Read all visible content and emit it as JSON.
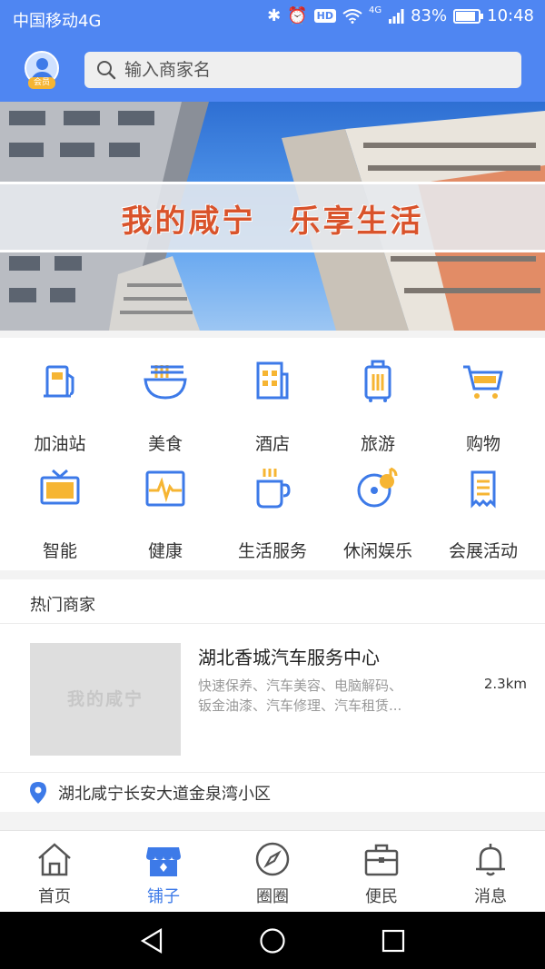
{
  "status_bar": {
    "carrier": "中国移动4G",
    "hd": "HD",
    "net": "4G",
    "battery": "83%",
    "time": "10:48"
  },
  "header": {
    "vip_badge": "会员",
    "search_placeholder": "输入商家名"
  },
  "banner": {
    "text": "我的咸宁　乐享生活"
  },
  "categories": [
    {
      "label": "加油站",
      "icon": "gas-station-icon"
    },
    {
      "label": "美食",
      "icon": "noodle-bowl-icon"
    },
    {
      "label": "酒店",
      "icon": "hotel-icon"
    },
    {
      "label": "旅游",
      "icon": "suitcase-icon"
    },
    {
      "label": "购物",
      "icon": "shopping-cart-icon"
    },
    {
      "label": "智能",
      "icon": "tv-icon"
    },
    {
      "label": "健康",
      "icon": "health-monitor-icon"
    },
    {
      "label": "生活服务",
      "icon": "coffee-cup-icon"
    },
    {
      "label": "休闲娱乐",
      "icon": "music-disc-icon"
    },
    {
      "label": "会展活动",
      "icon": "document-icon"
    }
  ],
  "hot": {
    "title": "热门商家",
    "merchant": {
      "thumb_text": "我的咸宁",
      "name": "湖北香城汽车服务中心",
      "tags_line1": "快速保养、汽车美容、电脑解码、",
      "tags_line2": "钣金油漆、汽车修理、汽车租赁...",
      "distance": "2.3km",
      "address": "湖北咸宁长安大道金泉湾小区"
    }
  },
  "tabs": [
    {
      "label": "首页",
      "icon": "home-icon"
    },
    {
      "label": "铺子",
      "icon": "shop-icon",
      "active": true
    },
    {
      "label": "圈圈",
      "icon": "compass-icon"
    },
    {
      "label": "便民",
      "icon": "briefcase-icon"
    },
    {
      "label": "消息",
      "icon": "bell-icon"
    }
  ],
  "colors": {
    "accent_blue": "#4f86f2",
    "icon_blue": "#3d7ae8",
    "icon_orange": "#f6b533",
    "banner_text": "#d9532b"
  }
}
